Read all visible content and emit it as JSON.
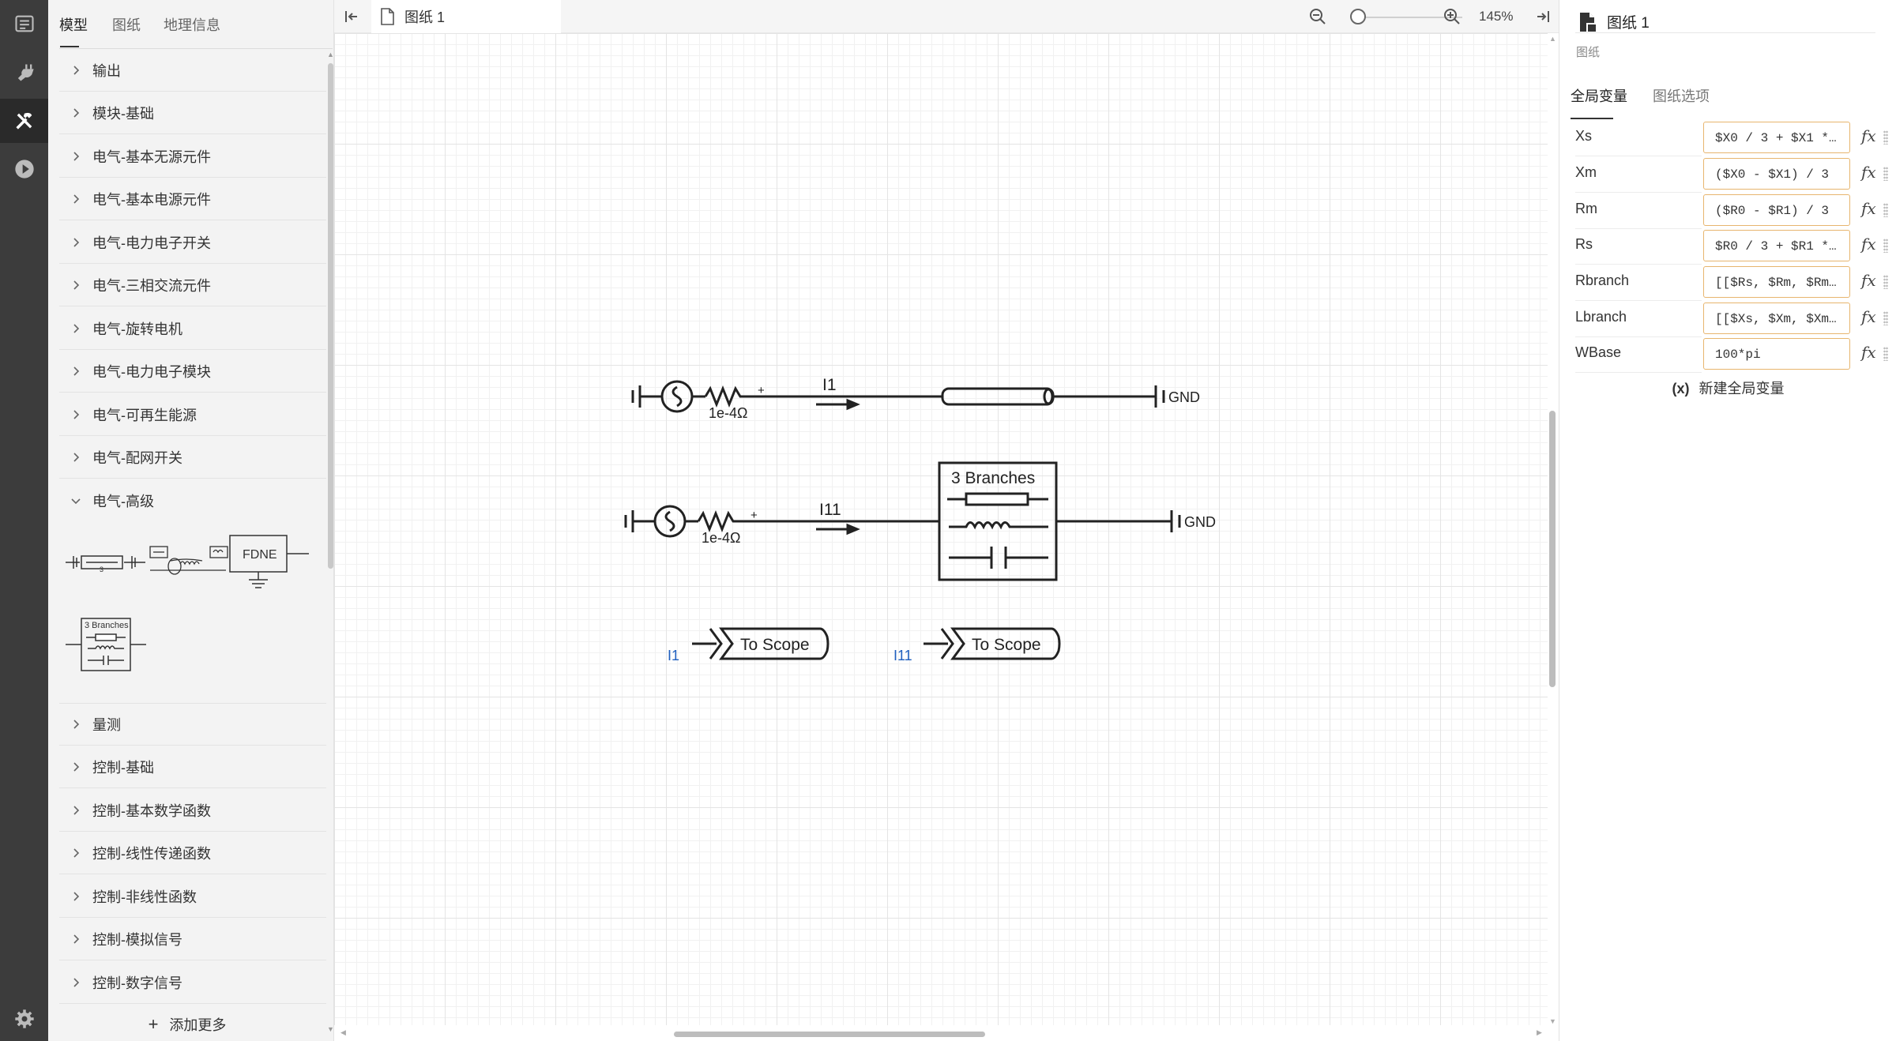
{
  "library": {
    "tabs": [
      "模型",
      "图纸",
      "地理信息"
    ],
    "categories_top": [
      "输出",
      "模块-基础",
      "电气-基本无源元件",
      "电气-基本电源元件",
      "电气-电力电子开关",
      "电气-三相交流元件",
      "电气-旋转电机",
      "电气-电力电子模块",
      "电气-可再生能源",
      "电气-配网开关",
      "电气-高级"
    ],
    "thumbs": {
      "fdne": "FDNE",
      "branches": "3 Branches",
      "tline_num": "3"
    },
    "categories_bottom": [
      "量测",
      "控制-基础",
      "控制-基本数学函数",
      "控制-线性传递函数",
      "控制-非线性函数",
      "控制-模拟信号",
      "控制-数字信号"
    ],
    "add_more": "添加更多"
  },
  "canvas": {
    "doc_tab": "图纸 1",
    "zoom": "145%",
    "schematic": {
      "r1_label": "1e-4Ω",
      "r2_label": "1e-4Ω",
      "i1_label": "I1",
      "i11_label": "I11",
      "gnd1": "GND",
      "gnd2": "GND",
      "plus1": "+",
      "plus2": "+",
      "branches_title": "3 Branches",
      "scope1_in": "I1",
      "scope1_label": "To Scope",
      "scope2_in": "I11",
      "scope2_label": "To Scope"
    }
  },
  "props": {
    "title": "图纸 1",
    "subtitle": "图纸",
    "tabs": [
      "全局变量",
      "图纸选项"
    ],
    "variables": [
      {
        "name": "Xs",
        "value": "$X0 / 3 + $X1 *…"
      },
      {
        "name": "Xm",
        "value": "($X0 - $X1) / 3"
      },
      {
        "name": "Rm",
        "value": "($R0 - $R1) / 3"
      },
      {
        "name": "Rs",
        "value": "$R0 / 3 + $R1 *…"
      },
      {
        "name": "Rbranch",
        "value": "[[$Rs, $Rm, $Rm…"
      },
      {
        "name": "Lbranch",
        "value": "[[$Xs, $Xm, $Xm…"
      },
      {
        "name": "WBase",
        "value": "100*pi"
      }
    ],
    "fx": "fx",
    "new_var_icon": "(x)",
    "new_var": "新建全局变量"
  },
  "colors": {
    "accent_border": "#e7b56e",
    "activity_bg": "#3c3c3c",
    "signal_blue": "#1f5fbf"
  }
}
